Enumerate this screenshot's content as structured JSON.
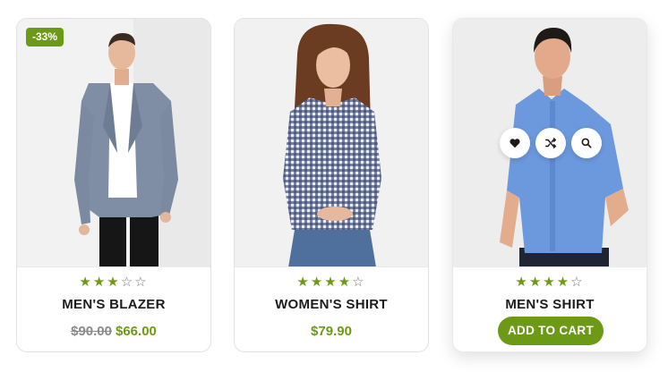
{
  "products": [
    {
      "badge": "-33%",
      "title": "MEN'S BLAZER",
      "rating": 3,
      "stars": [
        "★",
        "★",
        "★",
        "☆",
        "☆"
      ],
      "old_price": "$90.00",
      "price": "$66.00"
    },
    {
      "title": "WOMEN'S SHIRT",
      "rating": 4,
      "stars": [
        "★",
        "★",
        "★",
        "★",
        "☆"
      ],
      "price": "$79.90"
    },
    {
      "title": "MEN'S SHIRT",
      "rating": 4,
      "stars": [
        "★",
        "★",
        "★",
        "★",
        "☆"
      ],
      "add_to_cart_label": "ADD TO CART",
      "actions": [
        "heart-icon",
        "shuffle-icon",
        "search-icon"
      ]
    }
  ],
  "colors": {
    "accent": "#6c9a17",
    "old_price": "#8a8a8a",
    "title": "#1c1c1c"
  }
}
